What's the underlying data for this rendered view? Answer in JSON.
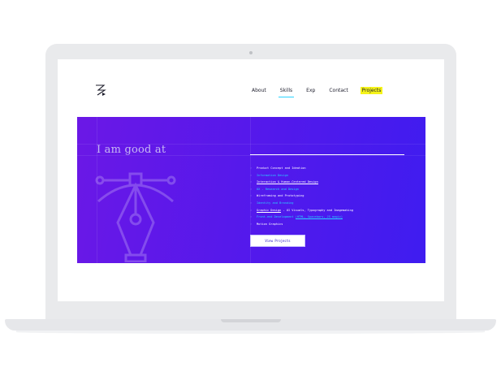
{
  "nav": {
    "items": [
      {
        "label": "About"
      },
      {
        "label": "Skills"
      },
      {
        "label": "Exp"
      },
      {
        "label": "Contact"
      },
      {
        "label": "Projects"
      }
    ]
  },
  "hero": {
    "title": "I am good at",
    "skills": [
      {
        "label": "Product Concept and Ideation"
      },
      {
        "label": "Information Design"
      },
      {
        "label": "Interaction & Human-Centered Design"
      },
      {
        "label": "UX - Research and Design"
      },
      {
        "label": "Wireframing and Prototyping"
      },
      {
        "label": "Identity and Branding"
      },
      {
        "label": "Graphic Design"
      },
      {
        "label": " - UI Visuals, Typography and Imagemaking"
      },
      {
        "label": "Front-end Development "
      },
      {
        "label": "(HTML, Spacebars, JS magic)"
      },
      {
        "label": "Motion Graphics"
      }
    ],
    "cta_label": "View Projects"
  },
  "colors": {
    "hero_gradient_start": "#6b18e6",
    "hero_gradient_end": "#3f1cf0",
    "accent_cyan": "#29d3ff",
    "highlight_yellow": "#f5f31a"
  },
  "icons": [
    "logo-mark-icon",
    "pen-tool-icon",
    "chevron-right-icon"
  ]
}
